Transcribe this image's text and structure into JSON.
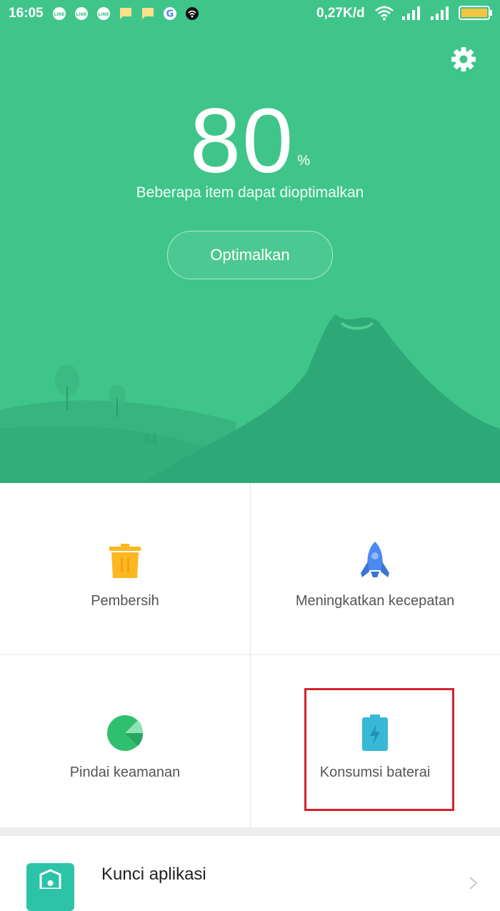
{
  "status_bar": {
    "time": "16:05",
    "notification_icons": [
      "line-icon",
      "line-icon",
      "line-icon",
      "message-icon",
      "message-icon",
      "google-icon",
      "wifi-app-icon"
    ],
    "net_speed": "0,27K/d",
    "right_icons": [
      "wifi-icon",
      "signal-icon",
      "signal-icon",
      "battery-icon"
    ]
  },
  "hero": {
    "score": "80",
    "score_unit": "%",
    "subtitle": "Beberapa item dapat dioptimalkan",
    "optimize_label": "Optimalkan",
    "settings_icon": "gear-icon",
    "background_color": "#3fc58a"
  },
  "grid": {
    "items": [
      {
        "label": "Pembersih",
        "icon": "trash-icon",
        "color": "#fbb821"
      },
      {
        "label": "Meningkatkan kecepatan",
        "icon": "rocket-icon",
        "color": "#4b8af0"
      },
      {
        "label": "Pindai keamanan",
        "icon": "security-scan-icon",
        "color": "#2fbf6e"
      },
      {
        "label": "Konsumsi baterai",
        "icon": "battery-charge-icon",
        "color": "#37b8d6"
      }
    ],
    "highlight_color": "#d3232f"
  },
  "list": {
    "items": [
      {
        "title": "Kunci aplikasi",
        "icon": "app-lock-icon",
        "color": "#2cc3a8"
      }
    ]
  }
}
